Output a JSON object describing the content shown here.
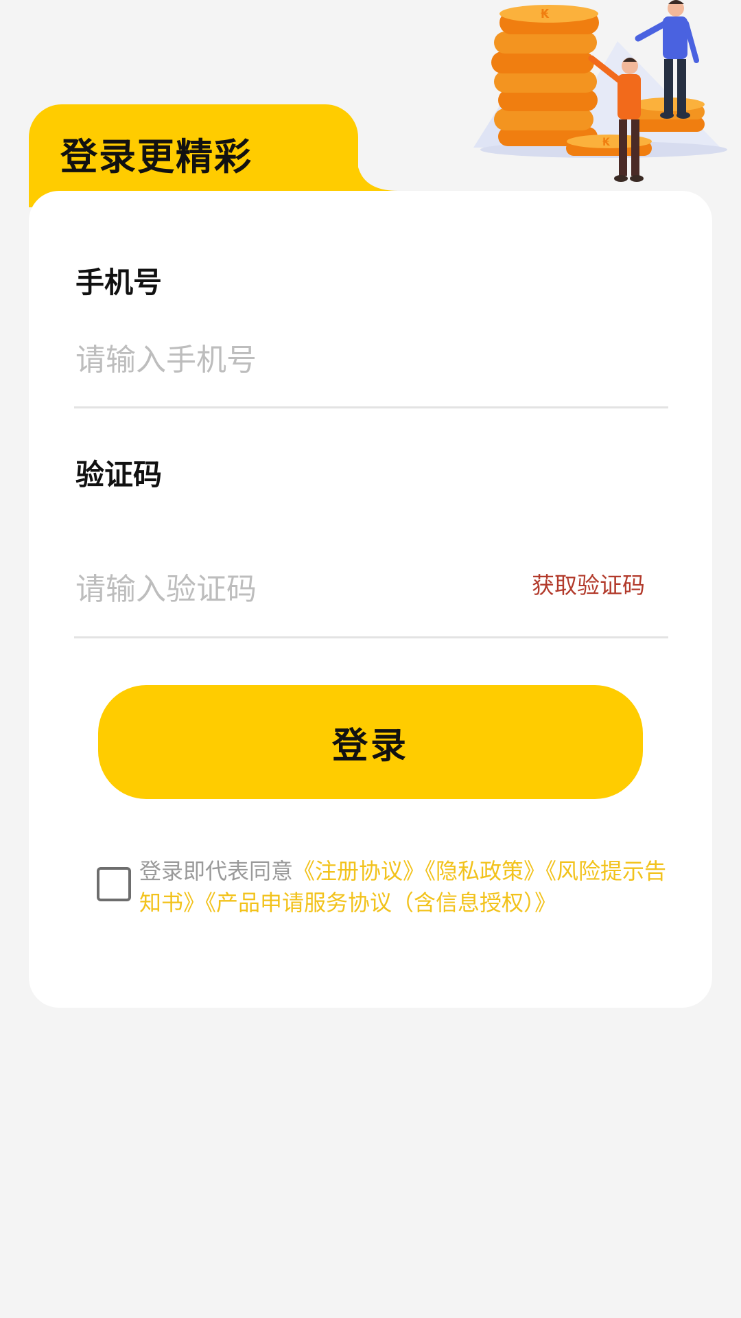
{
  "header": {
    "title": "登录更精彩"
  },
  "phone": {
    "label": "手机号",
    "placeholder": "请输入手机号"
  },
  "code": {
    "label": "验证码",
    "placeholder": "请输入验证码",
    "get_code": "获取验证码"
  },
  "login_button": {
    "label": "登录"
  },
  "agreement": {
    "prefix": "登录即代表同意",
    "links": [
      "《注册协议》",
      "《隐私政策》",
      "《风险提示告知书》",
      "《产品申请服务协议（含信息授权）》"
    ]
  },
  "colors": {
    "accent": "#ffcc00",
    "get_code": "#b23a2b",
    "link": "#f2c21b",
    "background": "#f4f4f4"
  },
  "icons": {
    "hero": "coins-and-people-illustration",
    "checkbox": "checkbox-unchecked"
  }
}
